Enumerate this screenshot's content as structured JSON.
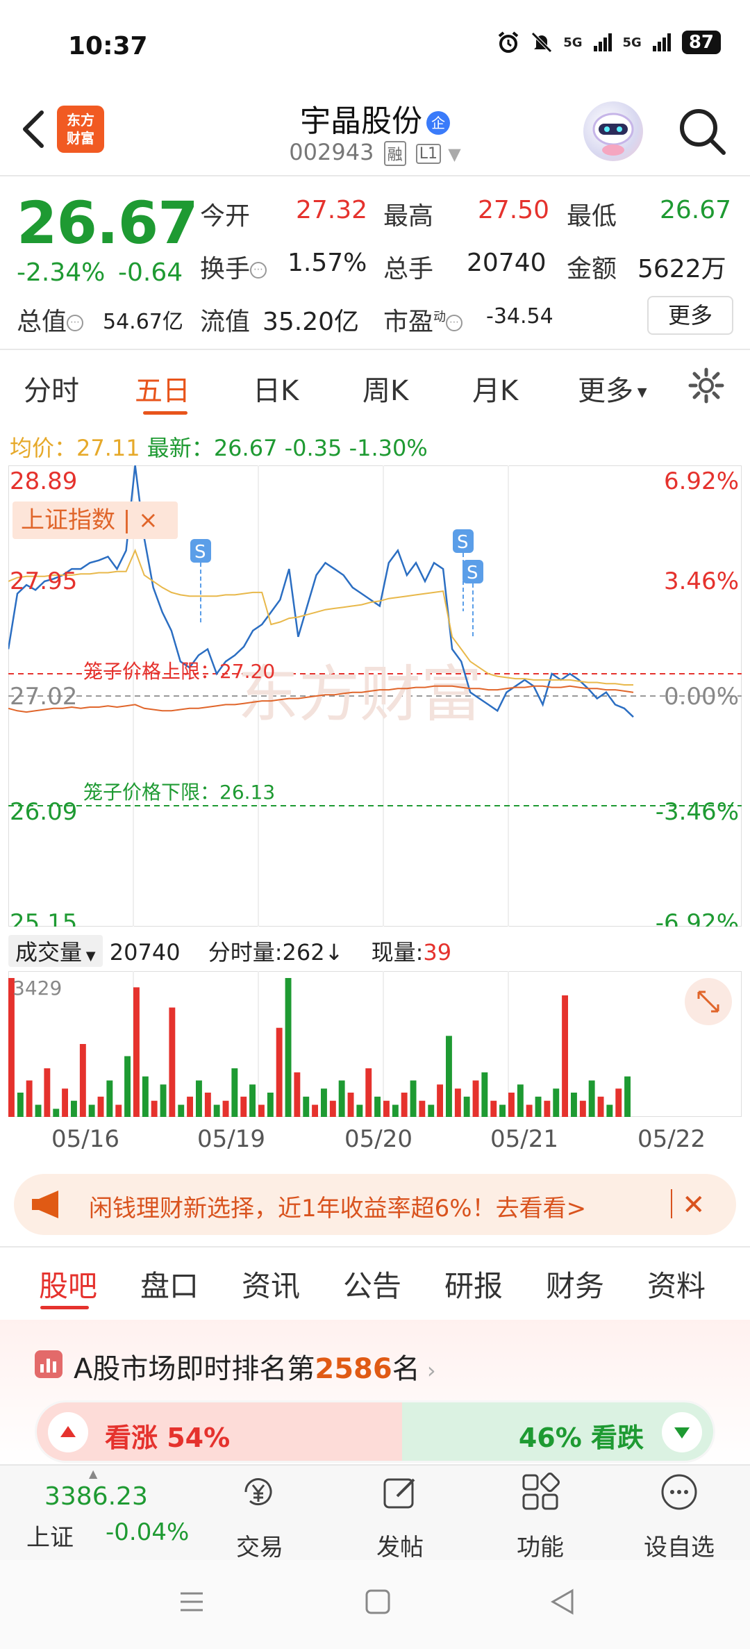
{
  "status_bar": {
    "time": "10:37",
    "battery": "87",
    "net1": "5G",
    "net2": "5G"
  },
  "header": {
    "logo_line1": "东方",
    "logo_line2": "财富",
    "stock_name": "宇晶股份",
    "enterprise_badge": "企",
    "stock_code": "002943",
    "tag_margin": "融",
    "tag_level": "L1"
  },
  "quote": {
    "price": "26.67",
    "change_pct": "-2.34%",
    "change_amt": "-0.64",
    "open_label": "今开",
    "open": "27.32",
    "high_label": "最高",
    "high": "27.50",
    "low_label": "最低",
    "low": "26.67",
    "turnover_label": "换手",
    "turnover": "1.57%",
    "volume_label": "总手",
    "volume": "20740",
    "amount_label": "金额",
    "amount": "5622万",
    "mktcap_label": "总值",
    "mktcap": "54.67亿",
    "float_label": "流值",
    "float_cap": "35.20亿",
    "pe_label": "市盈",
    "pe_sup": "动",
    "pe": "-34.54",
    "more_button": "更多"
  },
  "chart_tabs": [
    "分时",
    "五日",
    "日K",
    "周K",
    "月K",
    "更多"
  ],
  "avg_row": {
    "avg_label": "均价：",
    "avg": "27.11",
    "last_label": "最新：",
    "last": "26.67",
    "chg": "-0.35",
    "pct": "-1.30%"
  },
  "index_tag": "上证指数 | ×",
  "limit_labels": {
    "upper": "笼子价格上限：27.20",
    "lower": "笼子价格下限：26.13"
  },
  "watermark": "东方财富",
  "volume_header": {
    "select": "成交量",
    "total": "20740",
    "tick_label": "分时量:",
    "tick_val": "262",
    "tick_arrow": "↓",
    "now_label": "现量:",
    "now_val": "39"
  },
  "chart_data": {
    "type": "line",
    "title": "",
    "x_dates": [
      "05/16",
      "05/19",
      "05/20",
      "05/21",
      "05/22"
    ],
    "y_left_ticks": [
      "28.89",
      "27.95",
      "27.02",
      "26.09",
      "25.15"
    ],
    "y_right_ticks": [
      "6.92%",
      "3.46%",
      "0.00%",
      "-3.46%",
      "-6.92%"
    ],
    "ylim": [
      25.15,
      28.89
    ],
    "prev_close": 27.02,
    "limit_upper": 27.2,
    "limit_lower": 26.13,
    "series": [
      {
        "name": "",
        "color": "#2b6ec2",
        "values": [
          27.4,
          27.85,
          27.92,
          27.88,
          27.95,
          27.97,
          28.0,
          28.05,
          28.05,
          28.1,
          28.12,
          28.15,
          28.05,
          28.2,
          28.89,
          28.3,
          27.9,
          27.7,
          27.55,
          27.3,
          27.25,
          27.35,
          27.4,
          27.2,
          27.3,
          27.35,
          27.42,
          27.55,
          27.6,
          27.7,
          27.8,
          28.05,
          27.5,
          27.75,
          28.0,
          28.1,
          28.05,
          28.0,
          27.9,
          27.85,
          27.8,
          27.75,
          28.1,
          28.2,
          28.0,
          28.1,
          27.95,
          28.1,
          28.05,
          27.4,
          27.3,
          27.05,
          27.0,
          26.95,
          26.9,
          27.05,
          27.1,
          27.15,
          27.1,
          26.95,
          27.2,
          27.15,
          27.2,
          27.15,
          27.08,
          27.0,
          27.05,
          26.95,
          26.92,
          26.85
        ]
      },
      {
        "name": "",
        "color": "#e8b84a",
        "values": [
          27.95,
          27.98,
          27.99,
          27.99,
          27.99,
          28.0,
          28.0,
          28.0,
          28.01,
          28.01,
          28.02,
          28.02,
          28.03,
          28.03,
          28.2,
          28.0,
          27.95,
          27.9,
          27.86,
          27.84,
          27.83,
          27.83,
          27.83,
          27.83,
          27.84,
          27.84,
          27.85,
          27.86,
          27.86,
          27.6,
          27.62,
          27.65,
          27.66,
          27.68,
          27.7,
          27.72,
          27.73,
          27.74,
          27.75,
          27.76,
          27.78,
          27.79,
          27.81,
          27.82,
          27.83,
          27.84,
          27.85,
          27.86,
          27.87,
          27.5,
          27.4,
          27.3,
          27.25,
          27.2,
          27.18,
          27.17,
          27.16,
          27.16,
          27.15,
          27.15,
          27.15,
          27.15,
          27.15,
          27.14,
          27.13,
          27.13,
          27.12,
          27.12,
          27.11,
          27.11
        ]
      },
      {
        "name": "",
        "color": "#e0652a",
        "values": [
          26.92,
          26.9,
          26.89,
          26.9,
          26.91,
          26.92,
          26.92,
          26.93,
          26.92,
          26.93,
          26.93,
          26.94,
          26.93,
          26.94,
          26.95,
          26.92,
          26.91,
          26.9,
          26.9,
          26.91,
          26.92,
          26.92,
          26.93,
          26.94,
          26.95,
          26.95,
          26.96,
          26.97,
          26.98,
          26.98,
          26.99,
          27.0,
          27.0,
          27.01,
          27.02,
          27.03,
          27.03,
          27.04,
          27.05,
          27.05,
          27.06,
          27.07,
          27.07,
          27.08,
          27.08,
          27.09,
          27.09,
          27.1,
          27.1,
          27.1,
          27.09,
          27.08,
          27.08,
          27.07,
          27.07,
          27.08,
          27.09,
          27.09,
          27.1,
          27.1,
          27.09,
          27.09,
          27.1,
          27.09,
          27.08,
          27.08,
          27.07,
          27.07,
          27.06,
          27.05
        ]
      }
    ],
    "volume": {
      "max_label": "3429",
      "values": [
        3429,
        600,
        900,
        300,
        1200,
        200,
        700,
        400,
        1800,
        300,
        500,
        900,
        300,
        1500,
        3200,
        1000,
        400,
        800,
        2700,
        300,
        500,
        900,
        600,
        300,
        400,
        1200,
        500,
        800,
        300,
        600,
        2200,
        3429,
        1100,
        500,
        300,
        700,
        400,
        900,
        600,
        300,
        1200,
        500,
        400,
        300,
        600,
        900,
        400,
        300,
        800,
        2000,
        700,
        500,
        900,
        1100,
        400,
        300,
        600,
        800,
        300,
        500,
        400,
        700,
        3000,
        600,
        400,
        900,
        500,
        300,
        700,
        1000
      ],
      "colors": [
        "#e5322d",
        "#1e9a32"
      ]
    }
  },
  "ad_banner": {
    "text": "闲钱理财新选择，近1年收益率超6%！去看看>"
  },
  "section_tabs": [
    "股吧",
    "盘口",
    "资讯",
    "公告",
    "研报",
    "财务",
    "资料"
  ],
  "ranking": {
    "prefix": "A股市场即时排名第",
    "rank": "2586",
    "suffix": "名",
    "up_text": "看涨 54%",
    "down_text": "46% 看跌",
    "up_ratio": 0.54
  },
  "bottom_nav": {
    "index_value": "3386.23",
    "index_name": "上证",
    "index_pct": "-0.04%",
    "items": [
      "交易",
      "发帖",
      "功能",
      "设自选"
    ]
  }
}
